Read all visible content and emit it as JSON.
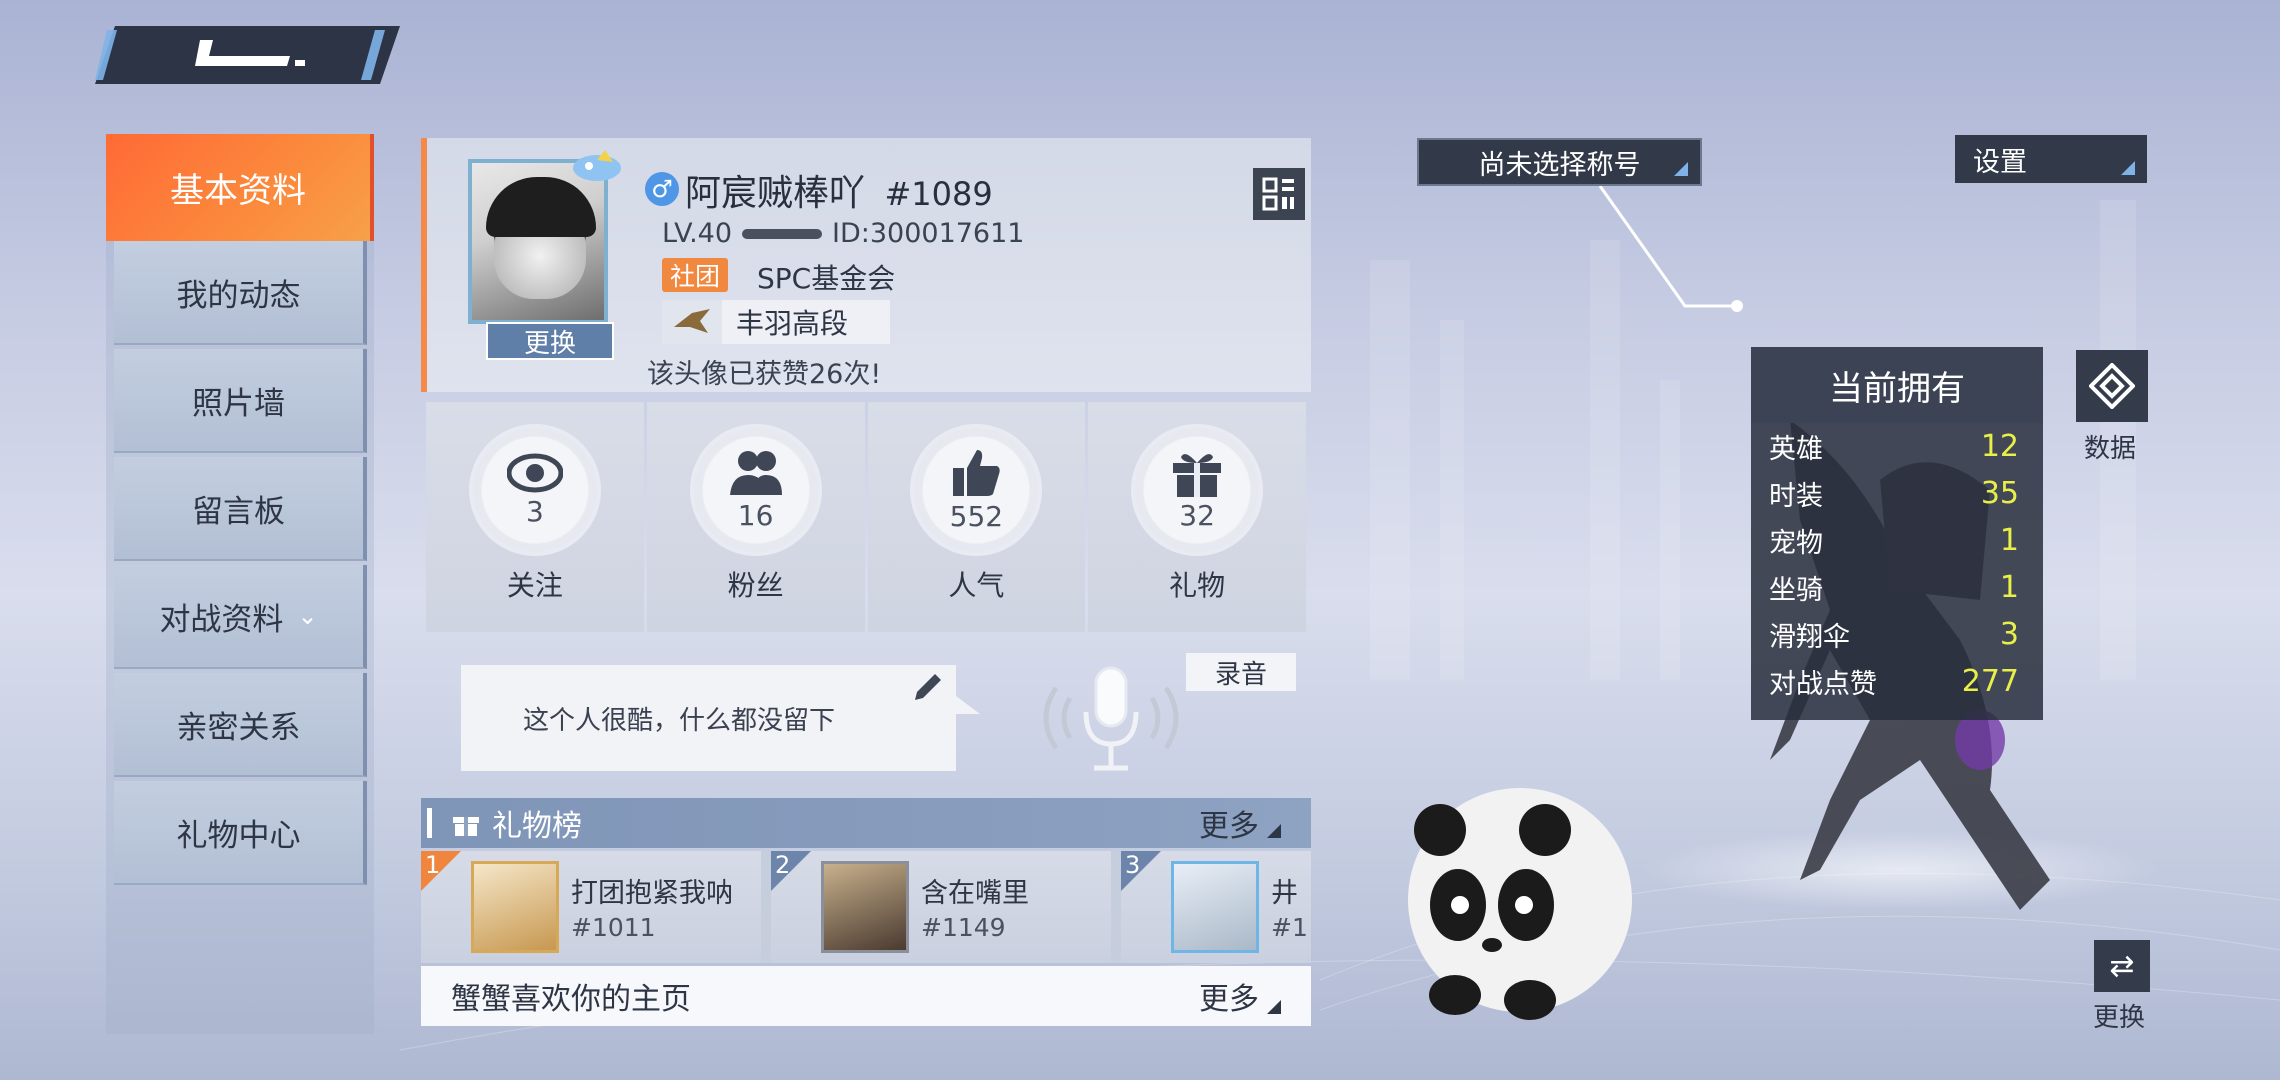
{
  "sidebar": {
    "items": [
      {
        "label": "基本资料"
      },
      {
        "label": "我的动态"
      },
      {
        "label": "照片墙"
      },
      {
        "label": "留言板"
      },
      {
        "label": "对战资料"
      },
      {
        "label": "亲密关系"
      },
      {
        "label": "礼物中心"
      }
    ]
  },
  "profile": {
    "name": "阿宸贼棒吖",
    "tag_number": "#1089",
    "level": "LV.40",
    "id": "ID:300017611",
    "guild_tag": "社团",
    "guild_name": "SPC基金会",
    "rank": "丰羽高段",
    "change_label": "更换",
    "likes_text": "该头像已获赞26次!"
  },
  "stats": [
    {
      "label": "关注",
      "value": "3",
      "icon": "eye-icon"
    },
    {
      "label": "粉丝",
      "value": "16",
      "icon": "fans-icon"
    },
    {
      "label": "人气",
      "value": "552",
      "icon": "thumbs-up-icon"
    },
    {
      "label": "礼物",
      "value": "32",
      "icon": "gift-icon"
    }
  ],
  "signature": {
    "text": "这个人很酷，什么都没留下",
    "record_label": "录音"
  },
  "gift_board": {
    "title": "礼物榜",
    "more_label": "更多",
    "entries": [
      {
        "rank": "1",
        "name": "打团抱紧我呐",
        "id": "#1011"
      },
      {
        "rank": "2",
        "name": "含在嘴里",
        "id": "#1149"
      },
      {
        "rank": "3",
        "name": "井",
        "id": "#1"
      }
    ]
  },
  "visitor": {
    "text": "蟹蟹喜欢你的主页",
    "more_label": "更多"
  },
  "header": {
    "title_select": "尚未选择称号",
    "settings": "设置"
  },
  "ownership": {
    "title": "当前拥有",
    "rows": [
      {
        "label": "英雄",
        "value": "12"
      },
      {
        "label": "时装",
        "value": "35"
      },
      {
        "label": "宠物",
        "value": "1"
      },
      {
        "label": "坐骑",
        "value": "1"
      },
      {
        "label": "滑翔伞",
        "value": "3"
      },
      {
        "label": "对战点赞",
        "value": "277"
      }
    ]
  },
  "side_buttons": {
    "data_label": "数据",
    "swap_label": "更换"
  },
  "colors": {
    "accent_orange": "#f5894a",
    "panel_dark": "#323a4a",
    "value_yellow": "#e8f048",
    "gender_blue": "#4f97e6"
  }
}
